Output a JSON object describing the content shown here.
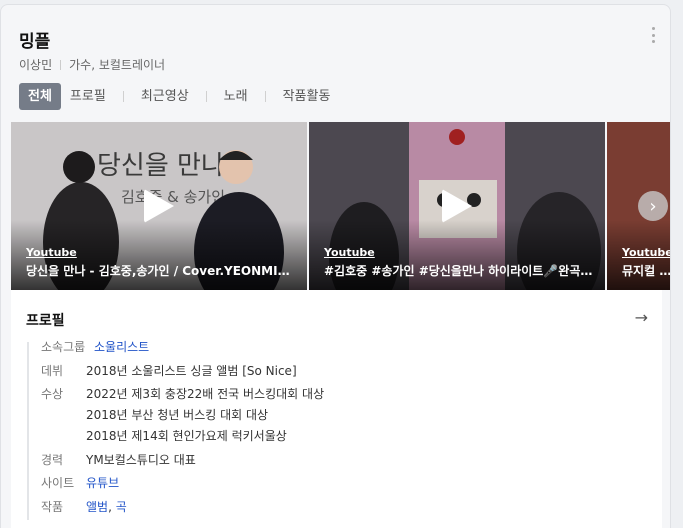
{
  "header": {
    "title": "밍플",
    "names": [
      "이상민",
      "가수, 보컬트레이너"
    ]
  },
  "tabs": [
    {
      "label": "전체",
      "active": true
    },
    {
      "label": "프로필",
      "active": false
    },
    {
      "label": "최근영상",
      "active": false
    },
    {
      "label": "노래",
      "active": false
    },
    {
      "label": "작품활동",
      "active": false
    }
  ],
  "videos": [
    {
      "source": "Youtube",
      "caption": "당신을 만나 - 김호중,송가인 / Cover.YEONMIN(노래하는연민)"
    },
    {
      "source": "Youtube",
      "caption": "#김호중 #송가인 #당신을만나 하이라이트🎤완곡-댓글"
    },
    {
      "source": "Youtube",
      "caption": "뮤지컬 베토벤"
    }
  ],
  "video_thumb_text": "당신을 만나",
  "video_thumb_sub": "김호중 & 송가인",
  "profile": {
    "title": "프로필",
    "rows": {
      "agency": {
        "label": "소속그룹",
        "value": "소울리스트"
      },
      "debut": {
        "label": "데뷔",
        "value": "2018년 소울리스트 싱글 앨범 [So Nice]"
      },
      "awards": {
        "label": "수상",
        "lines": [
          "2022년 제3회 충장22배 전국 버스킹대회 대상",
          "2018년 부산 청년 버스킹 대회 대상",
          "2018년 제14회 현인가요제 럭키서울상"
        ]
      },
      "career": {
        "label": "경력",
        "value": "YM보컬스튜디오 대표"
      },
      "site": {
        "label": "사이트",
        "value": "유튜브"
      },
      "works": {
        "label": "작품",
        "values": [
          "앨범",
          "곡"
        ],
        "sep": ", "
      }
    }
  },
  "colors": {
    "link": "#2254c8",
    "active_tab": "#757c88"
  }
}
